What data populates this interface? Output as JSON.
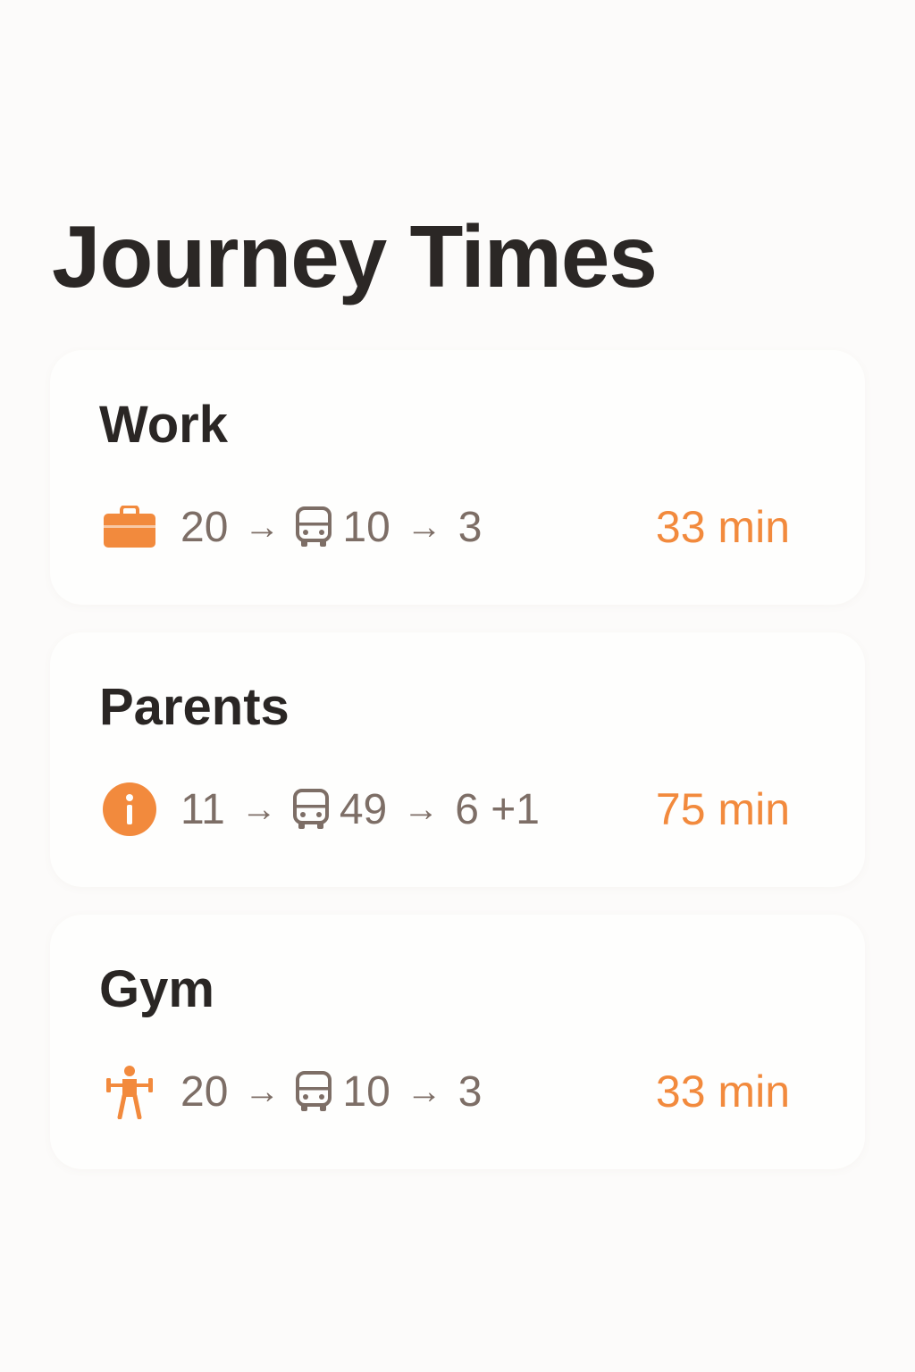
{
  "title": "Journey Times",
  "colors": {
    "accent": "#f28a3d",
    "route_text": "#7d6e66",
    "heading": "#2a2624"
  },
  "journeys": [
    {
      "name": "Work",
      "icon": "briefcase-icon",
      "walk_to_stop": "20",
      "arrow_1": "→",
      "bus_ride": "10",
      "arrow_2": "→",
      "walk_from_stop": "3",
      "duration": "33 min"
    },
    {
      "name": "Parents",
      "icon": "info-icon",
      "walk_to_stop": "11",
      "arrow_1": "→",
      "bus_ride": "49",
      "arrow_2": "→",
      "walk_from_stop": "6 +1",
      "duration": "75 min"
    },
    {
      "name": "Gym",
      "icon": "weightlifter-icon",
      "walk_to_stop": "20",
      "arrow_1": "→",
      "bus_ride": "10",
      "arrow_2": "→",
      "walk_from_stop": "3",
      "duration": "33 min"
    }
  ]
}
